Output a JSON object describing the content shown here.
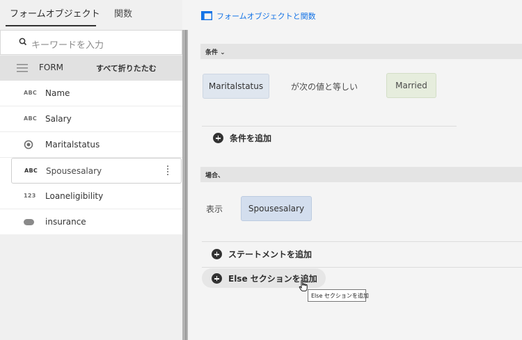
{
  "left_panel": {
    "tabs": [
      {
        "label": "フォームオブジェクト",
        "active": true
      },
      {
        "label": "関数",
        "active": false
      }
    ],
    "search": {
      "placeholder": "キーワードを入力",
      "icon": "search-icon"
    },
    "form_row": {
      "label": "FORM",
      "collapse_all": "すべて折りたたむ"
    },
    "items": [
      {
        "type_icon": "ABC",
        "label": "Name"
      },
      {
        "type_icon": "ABC",
        "label": "Salary"
      },
      {
        "type_icon": "radio-icon",
        "label": "Maritalstatus"
      },
      {
        "type_icon": "ABC",
        "label": "Spousesalary",
        "selected": true
      },
      {
        "type_icon": "123",
        "label": "Loaneligibility"
      },
      {
        "type_icon": "toggle-icon",
        "label": "insurance"
      }
    ]
  },
  "top_bar": {
    "link": "フォームオブジェクトと関数"
  },
  "condition_section": {
    "header": "条件",
    "left_operand": "Maritalstatus",
    "operator": "が次の値と等しい",
    "right_operand": "Married",
    "add_condition": "条件を追加"
  },
  "then_section": {
    "header": "場合、",
    "action": "表示",
    "target": "Spousesalary",
    "add_statement": "ステートメントを追加",
    "add_else": "Else セクションを追加",
    "tooltip": "Else セクションを追加"
  },
  "colors": {
    "accent": "#1473e6",
    "field_blue": "#dfe6ef",
    "value_green": "#e6eddd"
  }
}
